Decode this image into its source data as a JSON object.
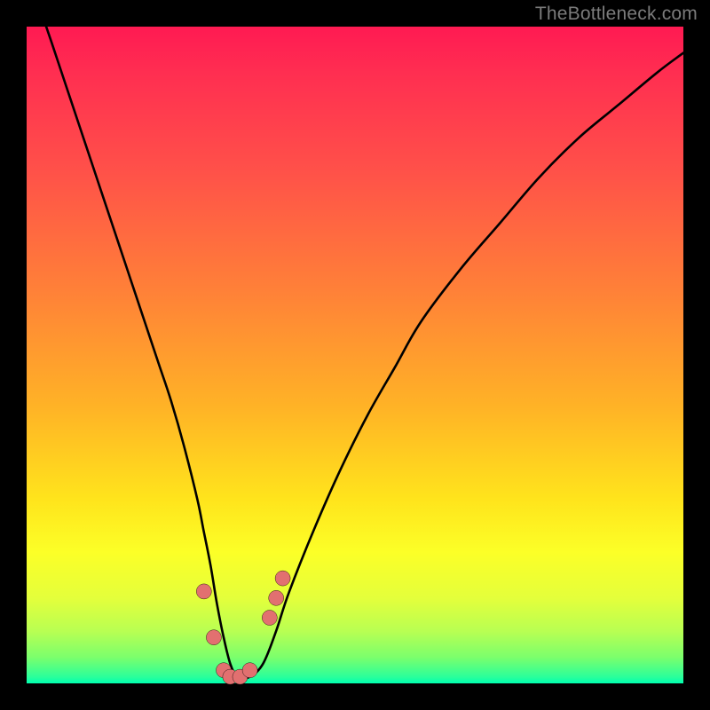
{
  "watermark": "TheBottleneck.com",
  "chart_data": {
    "type": "line",
    "title": "",
    "xlabel": "",
    "ylabel": "",
    "series": [
      {
        "name": "bottleneck-curve",
        "x": [
          0,
          2,
          4,
          6,
          8,
          10,
          12,
          14,
          16,
          18,
          20,
          22,
          24,
          26,
          27,
          28,
          29,
          30,
          31,
          32,
          33,
          34,
          36,
          38,
          40,
          44,
          48,
          52,
          56,
          60,
          66,
          72,
          78,
          84,
          90,
          96,
          100
        ],
        "y": [
          110,
          103,
          97,
          91,
          85,
          79,
          73,
          67,
          61,
          55,
          49,
          43,
          36,
          28,
          23,
          18,
          12,
          7,
          3,
          1,
          1,
          1,
          3,
          8,
          14,
          24,
          33,
          41,
          48,
          55,
          63,
          70,
          77,
          83,
          88,
          93,
          96
        ]
      }
    ],
    "markers": [
      {
        "x": 27.0,
        "y": 14
      },
      {
        "x": 28.5,
        "y": 7
      },
      {
        "x": 30.0,
        "y": 2
      },
      {
        "x": 31.0,
        "y": 1
      },
      {
        "x": 32.5,
        "y": 1
      },
      {
        "x": 34.0,
        "y": 2
      },
      {
        "x": 37.0,
        "y": 10
      },
      {
        "x": 38.0,
        "y": 13
      },
      {
        "x": 39.0,
        "y": 16
      }
    ],
    "xlim": [
      0,
      100
    ],
    "ylim": [
      0,
      100
    ],
    "gradient_stops": [
      {
        "pos": 0,
        "color": "#ff1a52"
      },
      {
        "pos": 80,
        "color": "#fcff27"
      },
      {
        "pos": 100,
        "color": "#00ffb0"
      }
    ]
  }
}
